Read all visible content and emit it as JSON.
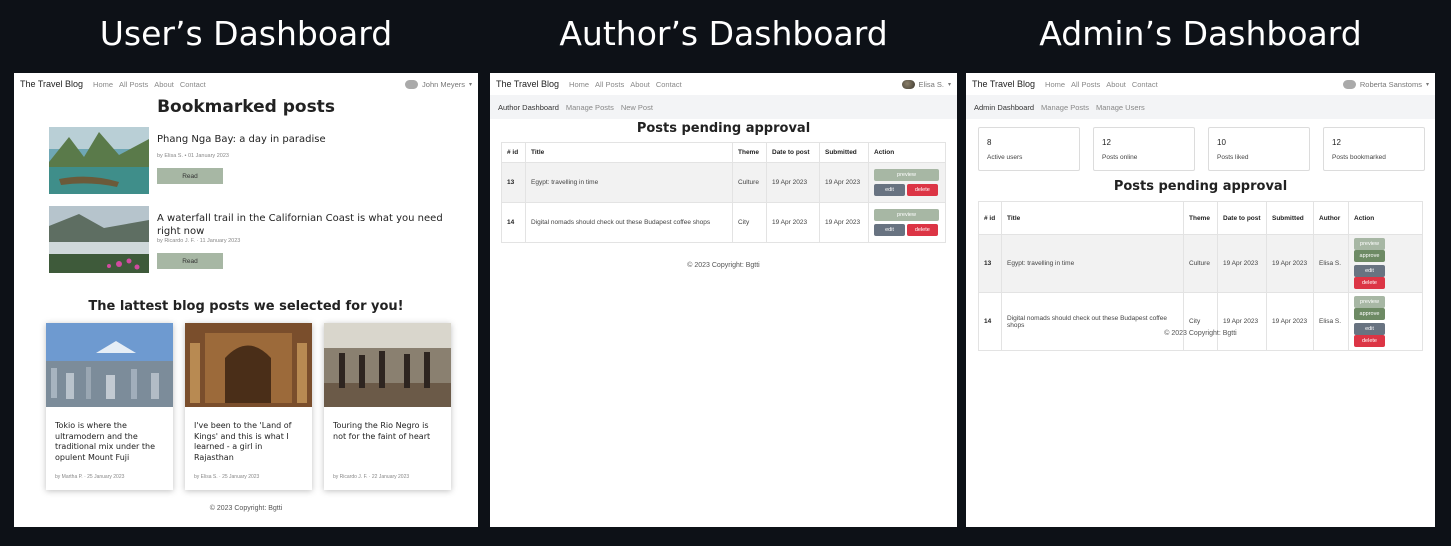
{
  "headings": {
    "user": "User’s Dashboard",
    "author": "Author’s Dashboard",
    "admin": "Admin’s Dashboard"
  },
  "nav": {
    "brand": "The Travel Blog",
    "links": [
      "Home",
      "All Posts",
      "About",
      "Contact"
    ]
  },
  "user_panel": {
    "username": "John Meyers",
    "bookmarked_title": "Bookmarked posts",
    "bookmarks": [
      {
        "title": "Phang Nga Bay: a day in paradise",
        "meta": "by Elisa S. • 01 January 2023",
        "button": "Read"
      },
      {
        "title": "A waterfall trail in the Californian Coast is what you need right now",
        "meta": "by Ricardo J. F. · 11 January 2023",
        "button": "Read"
      }
    ],
    "latest_title": "The lattest blog posts we selected for you!",
    "cards": [
      {
        "title": "Tokio is where the ultramodern and the traditional mix under the opulent Mount Fuji",
        "meta": "by Martha P. · 25 January 2023"
      },
      {
        "title": "I've been to the 'Land of Kings' and this is what I learned - a girl in Rajasthan",
        "meta": "by Elisa S. · 25 January 2023"
      },
      {
        "title": "Touring the Rio Negro is not for the faint of heart",
        "meta": "by Ricardo J. F. · 22 January 2023"
      }
    ],
    "footer": "© 2023 Copyright: Bgtti"
  },
  "author_panel": {
    "username": "Elisa S.",
    "subnav": [
      "Author Dashboard",
      "Manage Posts",
      "New Post"
    ],
    "title": "Posts pending approval",
    "columns": [
      "# id",
      "Title",
      "Theme",
      "Date to post",
      "Submitted",
      "Action"
    ],
    "rows": [
      {
        "id": "13",
        "title": "Egypt: travelling in time",
        "theme": "Culture",
        "date": "19 Apr 2023",
        "submitted": "19 Apr 2023"
      },
      {
        "id": "14",
        "title": "Digital nomads should check out these Budapest coffee shops",
        "theme": "City",
        "date": "19 Apr 2023",
        "submitted": "19 Apr 2023"
      }
    ],
    "buttons": {
      "preview": "preview",
      "edit": "edit",
      "delete": "delete"
    },
    "footer": "© 2023 Copyright: Bgtti"
  },
  "admin_panel": {
    "username": "Roberta Sanstoms",
    "subnav": [
      "Admin Dashboard",
      "Manage Posts",
      "Manage Users"
    ],
    "stats": [
      {
        "value": "8",
        "label": "Active users"
      },
      {
        "value": "12",
        "label": "Posts online"
      },
      {
        "value": "10",
        "label": "Posts liked"
      },
      {
        "value": "12",
        "label": "Posts bookmarked"
      }
    ],
    "title": "Posts pending approval",
    "columns": [
      "# id",
      "Title",
      "Theme",
      "Date to post",
      "Submitted",
      "Author",
      "Action"
    ],
    "rows": [
      {
        "id": "13",
        "title": "Egypt: travelling in time",
        "theme": "Culture",
        "date": "19 Apr 2023",
        "submitted": "19 Apr 2023",
        "author": "Elisa S."
      },
      {
        "id": "14",
        "title": "Digital nomads should check out these Budapest coffee shops",
        "theme": "City",
        "date": "19 Apr 2023",
        "submitted": "19 Apr 2023",
        "author": "Elisa S."
      }
    ],
    "buttons": {
      "preview": "preview",
      "approve": "approve",
      "edit": "edit",
      "delete": "delete"
    },
    "footer": "© 2023 Copyright: Bgtti"
  }
}
